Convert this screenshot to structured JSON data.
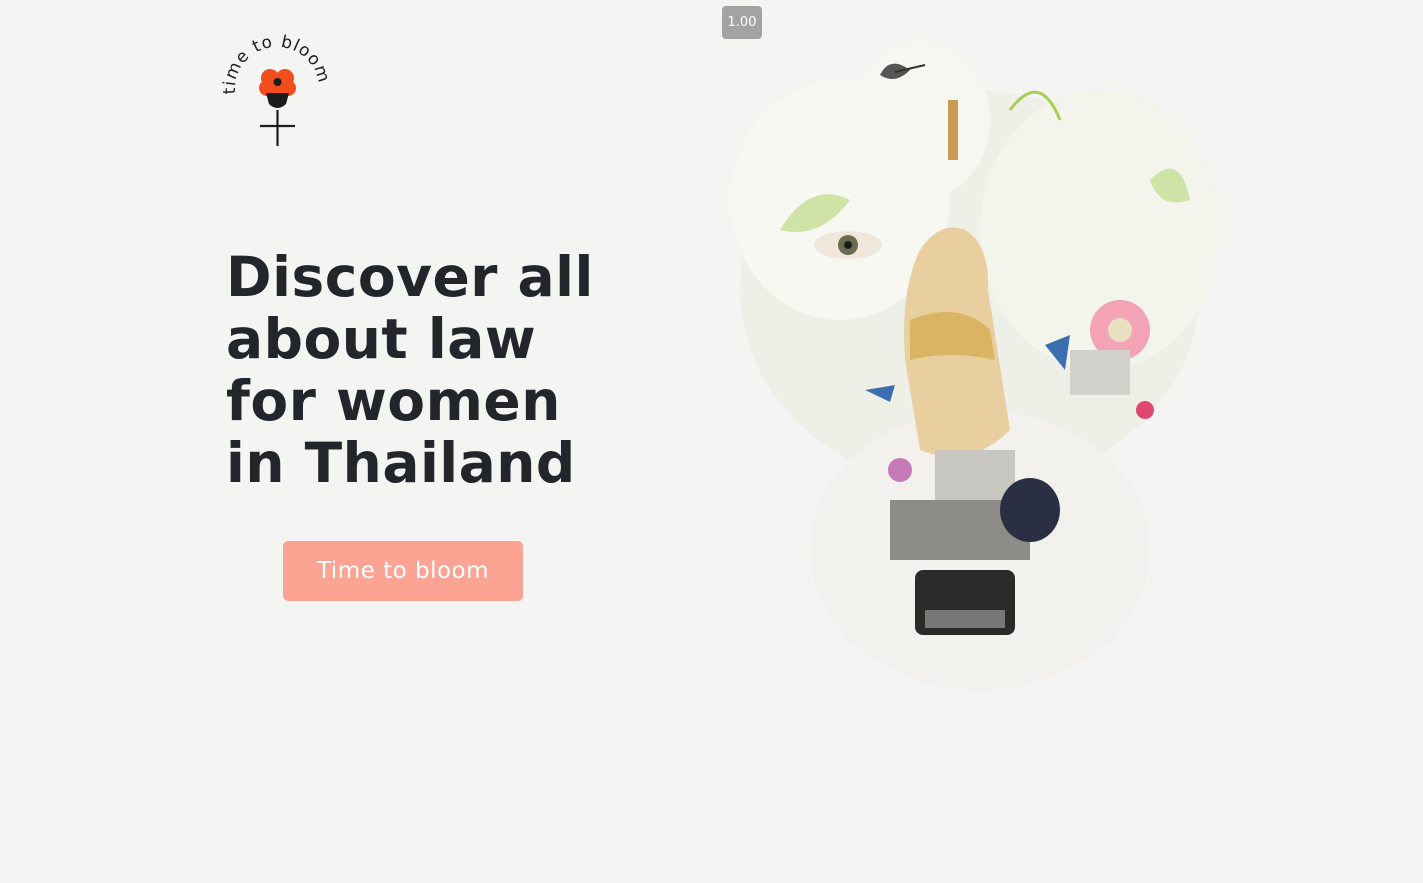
{
  "logo": {
    "text": "time to bloom",
    "flower_color": "#f34d1e",
    "center_color": "#1c1c1c"
  },
  "hero": {
    "headline_lines": [
      "Discover all",
      "about law",
      "for women",
      "in Thailand"
    ],
    "cta_label": "Time to bloom",
    "cta_color": "#fba493"
  },
  "zoom_badge": "1.00",
  "collage": {
    "description_icon": "floral-collage-illustration"
  }
}
